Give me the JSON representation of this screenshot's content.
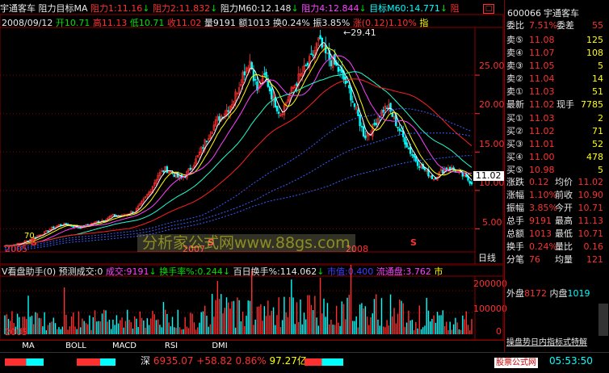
{
  "header": {
    "stock_name": "宇通客车",
    "indicator": "阻力目标MA",
    "resist1": "阻力1:11.16",
    "resist2": "阻力2:11.832",
    "resist_m60": "阻力M60:12.148",
    "resist4": "阻力4:12.844",
    "target_m60": "目标M60:14.771",
    "resist_tail": "阻"
  },
  "ohlc": {
    "date": "2008/09/12",
    "open": "开10.71",
    "high": "高11.13",
    "low": "低10.71",
    "close": "收11.02",
    "vol": "量9191",
    "amount": "额1013",
    "turnover": "换0.24%",
    "amplitude": "振3.85%",
    "change": "涨(0.12)1.10%",
    "tail": "指"
  },
  "price_chart": {
    "high_label": "29.41",
    "y_labels": [
      "25.00",
      "20.00",
      "15.00",
      "10.00",
      "5.00"
    ],
    "last_price_tag": "11.02",
    "year_labels": [
      "2005",
      "2007",
      "2008"
    ],
    "marker_left": "70",
    "marker_glyph": "S",
    "period": "日线",
    "watermark": "分析家公式网www.88gs.com"
  },
  "volume_panel": {
    "title": "V看盘助手(0)",
    "forecast": "预测成交:0",
    "volume": "成交:9191",
    "turnover_rate": "换手率%:0.244",
    "hundred_day": "百日换手%:114.062",
    "market_cap": "市值:0.400",
    "float_share": "流通盘:3.762",
    "tail": "市",
    "y_labels": [
      "200000",
      "100000"
    ],
    "zero": "0",
    "year_label": "2005"
  },
  "tabs": [
    "MA",
    "BOLL",
    "MACD",
    "RSI",
    "DMI"
  ],
  "quote": {
    "code": "600066",
    "name": "宇通客车",
    "wei_bi": "委比",
    "wei_bi_val": "7.51%",
    "wei_cha": "委差",
    "wei_cha_val": "55",
    "sells": [
      {
        "label": "卖⑤",
        "price": "11.08",
        "vol": "125"
      },
      {
        "label": "卖④",
        "price": "11.07",
        "vol": "108"
      },
      {
        "label": "卖③",
        "price": "11.05",
        "vol": "5"
      },
      {
        "label": "卖②",
        "price": "11.04",
        "vol": "14"
      },
      {
        "label": "卖①",
        "price": "11.03",
        "vol": "51"
      }
    ],
    "last": {
      "label": "最新",
      "price": "11.02",
      "now_label": "现手",
      "now_val": "7785"
    },
    "buys": [
      {
        "label": "买①",
        "price": "11.03",
        "vol": "2"
      },
      {
        "label": "买②",
        "price": "11.02",
        "vol": "71"
      },
      {
        "label": "买③",
        "price": "11.01",
        "vol": "52"
      },
      {
        "label": "买④",
        "price": "11.00",
        "vol": "478"
      },
      {
        "label": "买⑤",
        "price": "10.98",
        "vol": "5"
      }
    ],
    "stats": [
      {
        "l1": "涨跌",
        "v1": "0.12",
        "l2": "均价",
        "v2": "11.02"
      },
      {
        "l1": "涨幅",
        "v1": "1.10%",
        "l2": "前收",
        "v2": "10.90"
      },
      {
        "l1": "振幅",
        "v1": "3.85%",
        "l2": "今开",
        "v2": "10.71"
      },
      {
        "l1": "总手",
        "v1": "9191",
        "l2": "最高",
        "v2": "11.13"
      },
      {
        "l1": "总额",
        "v1": "1013",
        "l2": "最低",
        "v2": "10.71"
      },
      {
        "l1": "换手",
        "v1": "0.24%",
        "l2": "量比",
        "v2": "0.16"
      },
      {
        "l1": "分笔",
        "v1": "76",
        "l2": "均量",
        "v2": "121"
      }
    ],
    "outer_label": "外盘",
    "outer_val": "8172",
    "inner_label": "内盘",
    "inner_val": "1019",
    "bottom_link": "操盘势日内指标式特解"
  },
  "status_bar": {
    "index_name": "深",
    "index_val": "6935.07",
    "change": "+58.82",
    "pct": "0.86%",
    "amount": "97.27亿",
    "site": "股票公式网",
    "time": "05:53:50"
  },
  "colors": {
    "up": "#ff3030",
    "down": "#00ffff",
    "frame": "#8b0000",
    "yellow": "#ffff00",
    "bg": "#000000"
  },
  "chart_data": {
    "type": "candlestick",
    "x_axis_years": [
      "2005",
      "2007",
      "2008"
    ],
    "y_ticks": [
      25,
      20,
      15,
      10,
      5
    ],
    "ylim": [
      2,
      31
    ],
    "peak": 29.41,
    "last_close": 11.02,
    "close_series": [
      2.8,
      2.9,
      3.1,
      3.5,
      4.0,
      4.4,
      5.0,
      5.5,
      5.6,
      5.3,
      5.2,
      5.6,
      5.9,
      6.2,
      6.7,
      6.6,
      7.0,
      7.3,
      8.5,
      10.0,
      12.0,
      12.8,
      12.2,
      11.5,
      12.5,
      14.0,
      16.0,
      18.0,
      19.5,
      20.5,
      22.0,
      25.0,
      27.0,
      23.0,
      25.0,
      22.0,
      20.0,
      22.0,
      24.0,
      25.5,
      27.0,
      29.41,
      27.5,
      26.5,
      25.0,
      23.0,
      20.0,
      17.0,
      18.0,
      20.0,
      21.0,
      19.0,
      17.0,
      15.0,
      13.5,
      12.5,
      11.5,
      12.5,
      13.0,
      12.5,
      11.8,
      11.02
    ]
  }
}
